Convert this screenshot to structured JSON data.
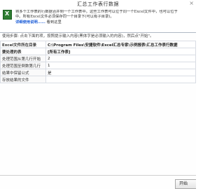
{
  "window": {
    "title": "汇总工作表行数据",
    "close_glyph": "×"
  },
  "header": {
    "line1": "将多个工作表的行数据合并到一个工作表中。这些工作表可以位于同一个Excel文件中，也可以位于",
    "line2": "中。所有Excel文件必须保存同一个目录下(可以有子目录)。",
    "link_text": "详细使用说明......",
    "link_suffix": "看到这里"
  },
  "info": "使用步骤: 点击下面的项，按照提示输入内容(黑体字是必须输入的内容)，然后点\"开始\"。",
  "settings": [
    {
      "label": "Excel文件所在目录",
      "value": "C:\\Program Files\\安捷软件\\Excel汇总专家\\示例报表\\汇总工作表行数据",
      "bold": true
    },
    {
      "label": "要处理的表",
      "value": "[所有工作表]",
      "bold": true
    },
    {
      "label": "处理范围从第几行开始",
      "value": "2",
      "bold": false
    },
    {
      "label": "处理范围至倒数第几行",
      "value": "1",
      "bold": false
    },
    {
      "label": "结果中保留公式",
      "value": "是",
      "bold": false
    },
    {
      "label": "存放结果的文件",
      "value": "",
      "bold": false
    }
  ],
  "buttons": {
    "start": "开始"
  },
  "colors": {
    "link": "#1f5fd8",
    "icon": "#2e7d32",
    "border": "#d9dde4"
  }
}
